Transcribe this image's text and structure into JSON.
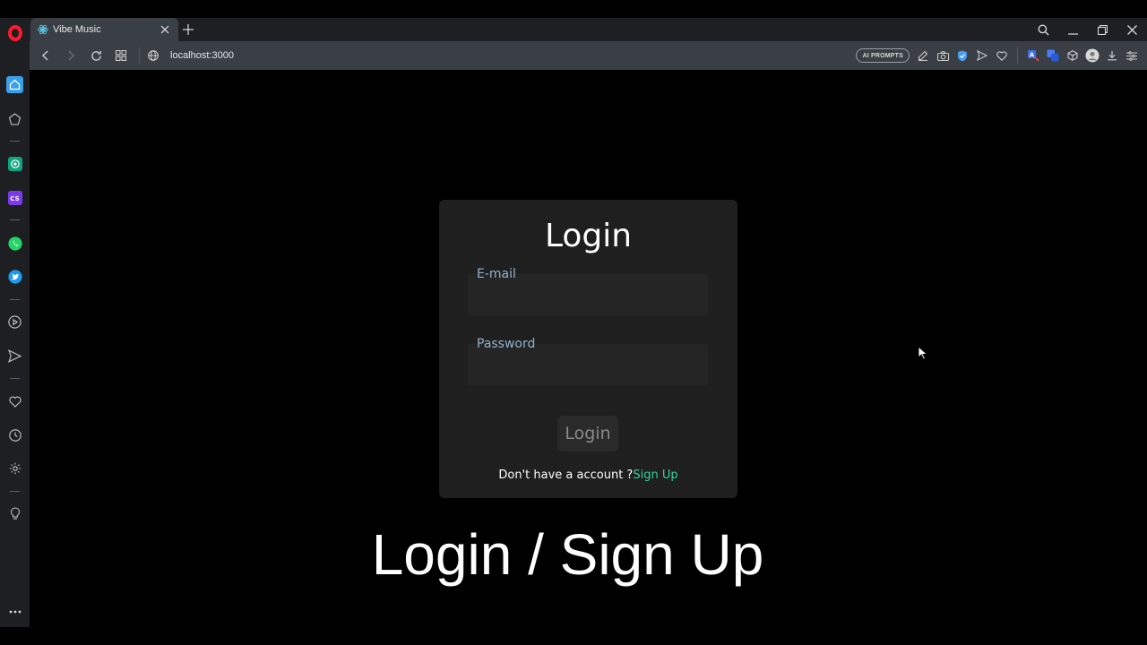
{
  "browser": {
    "tab": {
      "title": "Vibe Music"
    },
    "address": {
      "url": "localhost:3000"
    },
    "toolbar": {
      "ai_prompts_label": "AI PROMPTS"
    },
    "icons": {
      "sidebar": [
        "home-icon",
        "speed-dial-icon",
        "chatgpt-icon",
        "cs-icon",
        "whatsapp-icon",
        "twitter-icon",
        "player-icon",
        "send-icon",
        "heart-icon",
        "history-icon",
        "settings-icon",
        "lightbulb-icon",
        "more-icon"
      ]
    },
    "colors": {
      "opera_red": "#ff1b2d",
      "signup_link": "#34d399",
      "label": "#8fb3cc"
    }
  },
  "login": {
    "title": "Login",
    "email_label": "E-mail",
    "email_value": "",
    "password_label": "Password",
    "password_value": "",
    "submit_label": "Login",
    "signup_prompt": "Don't have a account ?",
    "signup_link": "Sign Up"
  },
  "caption": "Login / Sign Up"
}
